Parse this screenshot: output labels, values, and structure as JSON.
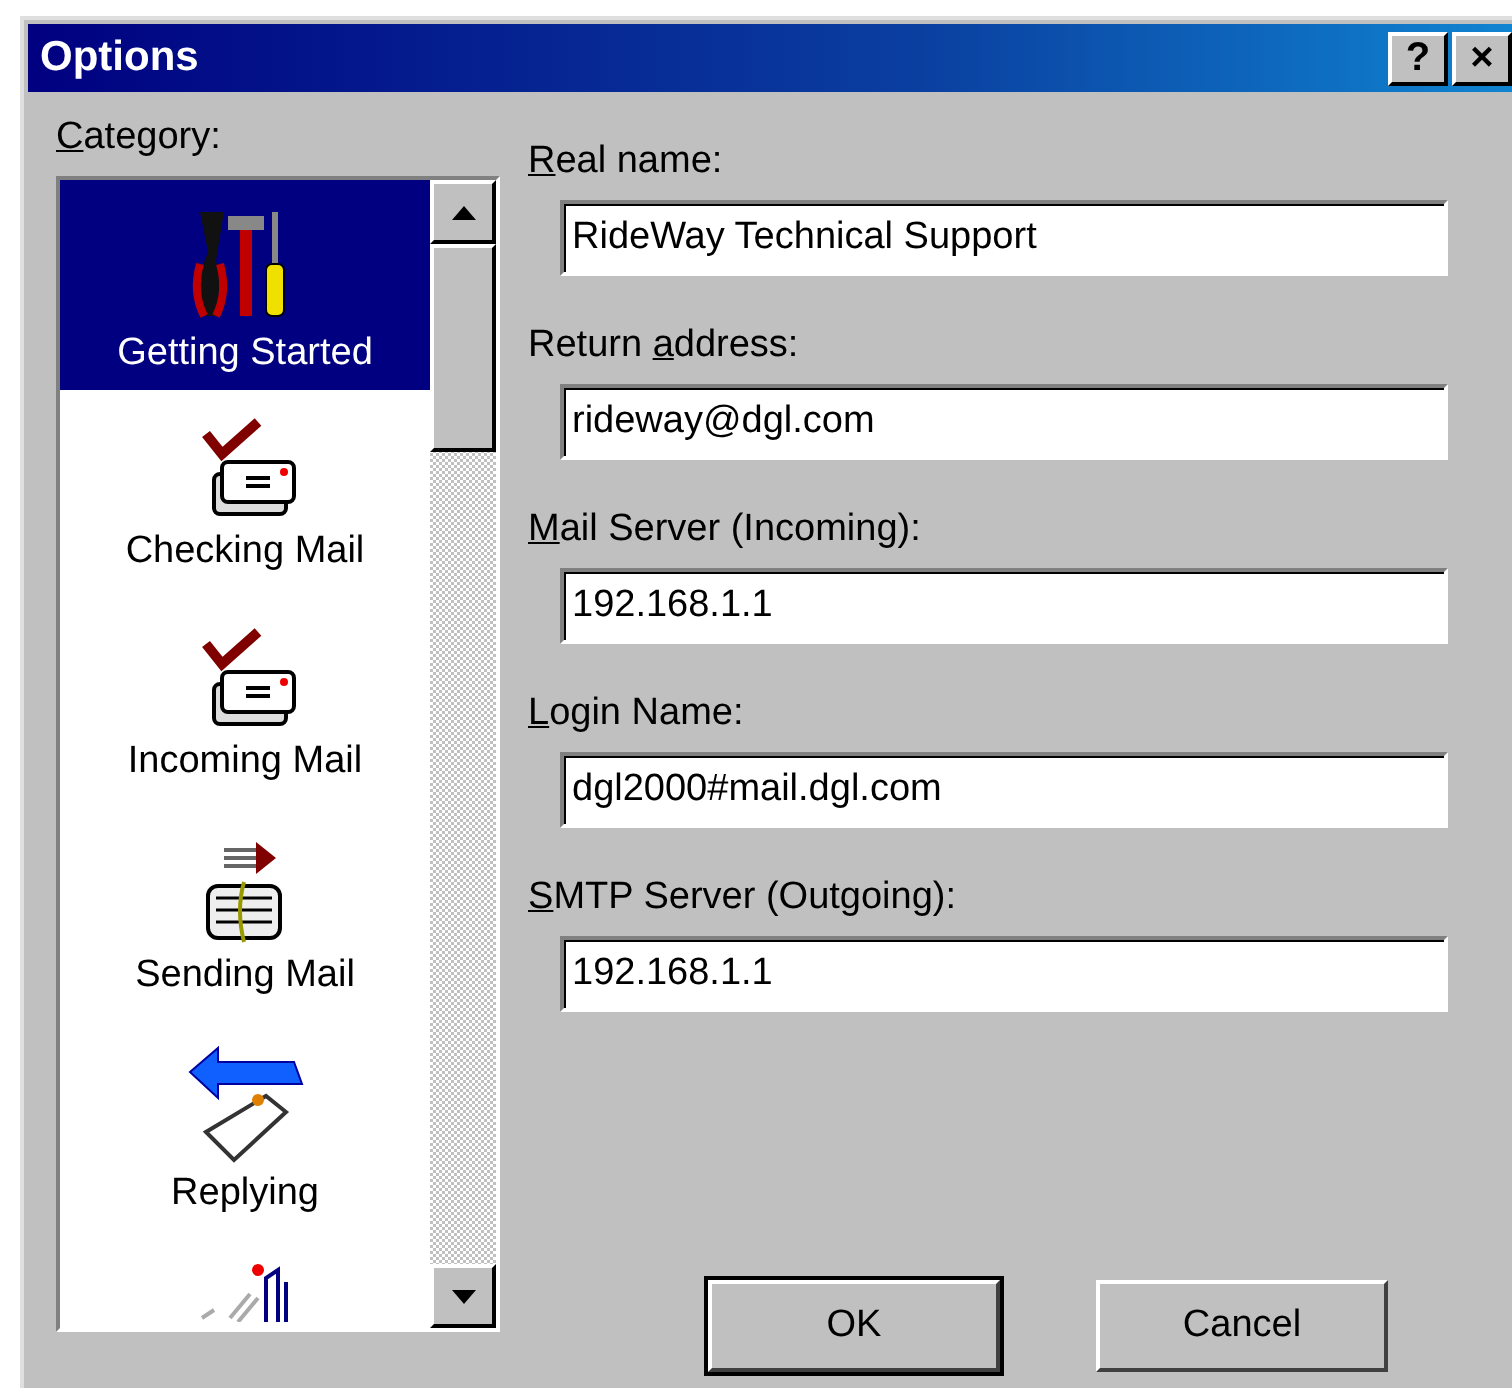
{
  "window": {
    "title": "Options",
    "title_buttons": [
      "?",
      "×"
    ]
  },
  "category": {
    "label": {
      "key": "C",
      "after": "ategory:"
    },
    "items": [
      {
        "kind": "tools",
        "label": "Getting Started",
        "selected": true
      },
      {
        "kind": "check-mail",
        "label": "Checking Mail",
        "selected": false
      },
      {
        "kind": "check-mail",
        "label": "Incoming Mail",
        "selected": false
      },
      {
        "kind": "send-mail",
        "label": "Sending Mail",
        "selected": false
      },
      {
        "kind": "reply",
        "label": "Replying",
        "selected": false
      },
      {
        "kind": "partial",
        "selected": false
      }
    ]
  },
  "fields": [
    {
      "label": {
        "key": "R",
        "after": "eal name:"
      },
      "value": "RideWay Technical Support"
    },
    {
      "label": {
        "before": "Return ",
        "key": "a",
        "after": "ddress:"
      },
      "value": "rideway@dgl.com"
    },
    {
      "label": {
        "key": "M",
        "after": "ail Server (Incoming):"
      },
      "value": "192.168.1.1"
    },
    {
      "label": {
        "key": "L",
        "after": "ogin Name:"
      },
      "value": "dgl2000#mail.dgl.com"
    },
    {
      "label": {
        "key": "S",
        "after": "MTP Server (Outgoing):"
      },
      "value": "192.168.1.1"
    }
  ],
  "buttons": [
    {
      "label": "OK",
      "default": true
    },
    {
      "label": "Cancel",
      "default": false
    }
  ]
}
